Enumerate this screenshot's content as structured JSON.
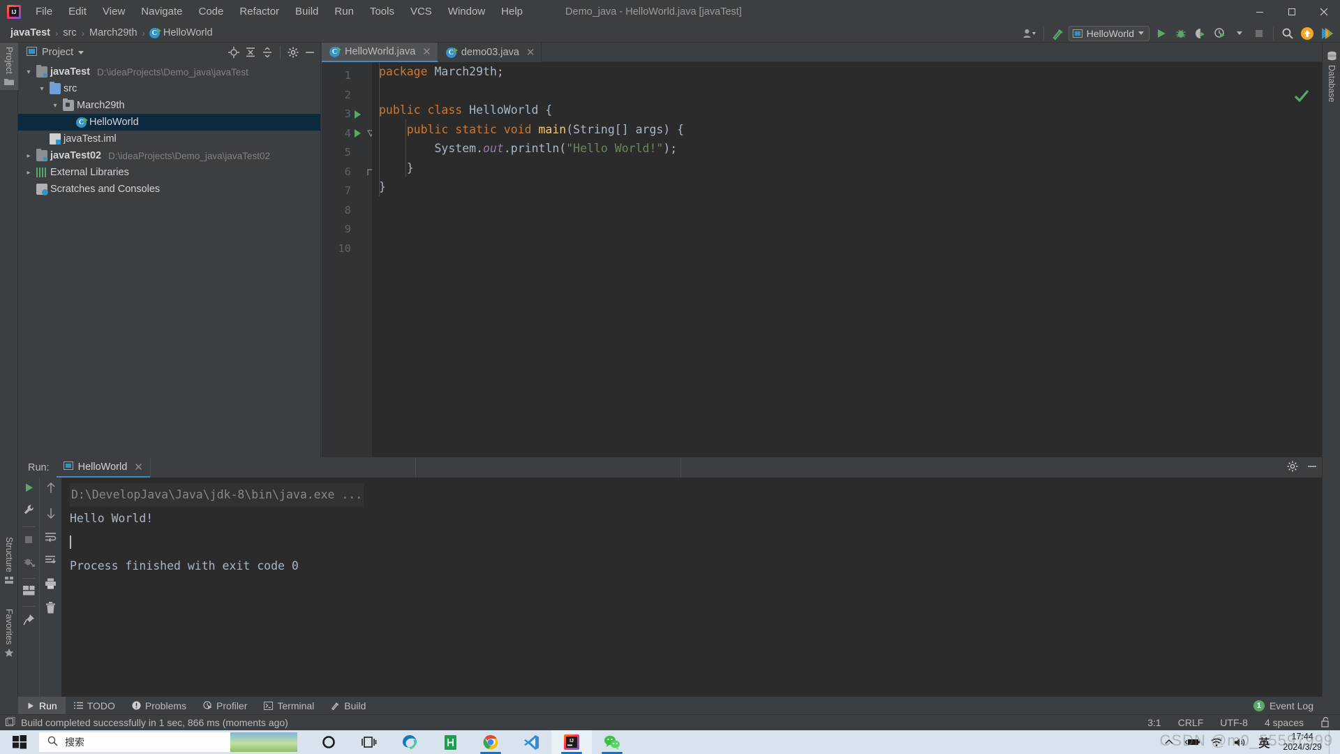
{
  "window": {
    "title": "Demo_java - HelloWorld.java [javaTest]",
    "app_icon": "intellij-idea-logo",
    "controls": {
      "minimize": "—",
      "maximize": "▢",
      "close": "✕"
    }
  },
  "menubar": {
    "items": [
      "File",
      "Edit",
      "View",
      "Navigate",
      "Code",
      "Refactor",
      "Build",
      "Run",
      "Tools",
      "VCS",
      "Window",
      "Help"
    ]
  },
  "navbar": {
    "breadcrumbs": [
      "javaTest",
      "src",
      "March29th",
      "HelloWorld"
    ],
    "separator": "›",
    "run_config": "HelloWorld",
    "actions": [
      "user-avatar-icon",
      "hammer-build-icon",
      "run-icon",
      "debug-icon",
      "coverage-icon",
      "profile-icon",
      "stop-icon",
      "search-everywhere-icon",
      "update-icon",
      "plugin-icon"
    ]
  },
  "left_strip": {
    "tabs": [
      {
        "label": "Project",
        "icon": "project-folder-icon",
        "active": true
      },
      {
        "label": "Structure",
        "icon": "structure-icon",
        "active": false
      },
      {
        "label": "Favorites",
        "icon": "star-icon",
        "active": false
      }
    ]
  },
  "right_strip": {
    "tabs": [
      {
        "label": "Database",
        "icon": "database-icon"
      }
    ]
  },
  "project_panel": {
    "title": "Project",
    "title_icon": "project-icon",
    "actions": [
      "locate-icon",
      "expand-all-icon",
      "collapse-all-icon",
      "settings-gear-icon",
      "hide-icon"
    ],
    "tree": [
      {
        "depth": 0,
        "arrow": "⌄",
        "icon": "module-icon",
        "label": "javaTest",
        "bold": true,
        "path": "D:\\ideaProjects\\Demo_java\\javaTest",
        "selected": false
      },
      {
        "depth": 1,
        "arrow": "⌄",
        "icon": "folder-icon",
        "label": "src",
        "bold": false,
        "path": "",
        "selected": false
      },
      {
        "depth": 2,
        "arrow": "⌄",
        "icon": "package-icon",
        "label": "March29th",
        "bold": false,
        "path": "",
        "selected": false
      },
      {
        "depth": 3,
        "arrow": "",
        "icon": "java-class-icon",
        "label": "HelloWorld",
        "bold": false,
        "path": "",
        "selected": true
      },
      {
        "depth": 1,
        "arrow": "",
        "icon": "iml-file-icon",
        "label": "javaTest.iml",
        "bold": false,
        "path": "",
        "selected": false
      },
      {
        "depth": 0,
        "arrow": "›",
        "icon": "module-icon",
        "label": "javaTest02",
        "bold": true,
        "path": "D:\\ideaProjects\\Demo_java\\javaTest02",
        "selected": false
      },
      {
        "depth": 0,
        "arrow": "›",
        "icon": "external-libraries-icon",
        "label": "External Libraries",
        "bold": false,
        "path": "",
        "selected": false
      },
      {
        "depth": 0,
        "arrow": "",
        "icon": "scratches-icon",
        "label": "Scratches and Consoles",
        "bold": false,
        "path": "",
        "selected": false
      }
    ]
  },
  "editor": {
    "tabs": [
      {
        "label": "HelloWorld.java",
        "icon": "java-class-icon",
        "active": true,
        "close": "✕"
      },
      {
        "label": "demo03.java",
        "icon": "java-class-icon",
        "active": false,
        "close": "✕"
      }
    ],
    "line_numbers": [
      "1",
      "2",
      "3",
      "4",
      "5",
      "6",
      "7",
      "8",
      "9",
      "10"
    ],
    "run_markers": [
      3,
      4
    ],
    "fold_markers": [
      4,
      6
    ],
    "inspection_status": "ok-checkmark",
    "lines": [
      [
        {
          "t": "package ",
          "c": "kw"
        },
        {
          "t": "March29th;",
          "c": "plain"
        }
      ],
      [],
      [
        {
          "t": "public class ",
          "c": "kw"
        },
        {
          "t": "HelloWorld {",
          "c": "plain"
        }
      ],
      [
        {
          "t": "    public static void ",
          "c": "kw"
        },
        {
          "t": "main",
          "c": "meth"
        },
        {
          "t": "(String[] args) {",
          "c": "plain"
        }
      ],
      [
        {
          "t": "        System.",
          "c": "plain"
        },
        {
          "t": "out",
          "c": "fld"
        },
        {
          "t": ".println(",
          "c": "plain"
        },
        {
          "t": "\"Hello World!\"",
          "c": "str"
        },
        {
          "t": ");",
          "c": "plain"
        }
      ],
      [
        {
          "t": "    }",
          "c": "plain"
        }
      ],
      [
        {
          "t": "}",
          "c": "plain"
        }
      ],
      [],
      [],
      []
    ]
  },
  "run_panel": {
    "label": "Run:",
    "tab": "HelloWorld",
    "tab_icon": "run-config-icon",
    "tab_close": "✕",
    "header_actions": [
      "settings-gear-icon",
      "hide-icon"
    ],
    "left_tools": [
      "rerun-icon",
      "wrench-settings-icon",
      "stop-icon",
      "debug-attach-icon",
      "layout-icon",
      "pin-icon"
    ],
    "right_tools": [
      "up-arrow-icon",
      "down-arrow-icon",
      "soft-wrap-icon",
      "scroll-to-end-icon",
      "print-icon",
      "trash-icon"
    ],
    "output": [
      {
        "text": "D:\\DevelopJava\\Java\\jdk-8\\bin\\java.exe ...",
        "style": "cmd"
      },
      {
        "text": "Hello World!",
        "style": "normal"
      },
      {
        "text": "",
        "style": "caret"
      },
      {
        "text": "Process finished with exit code 0",
        "style": "normal"
      }
    ]
  },
  "bottom_tabs": {
    "items": [
      {
        "label": "Run",
        "icon": "run-icon",
        "active": true
      },
      {
        "label": "TODO",
        "icon": "todo-list-icon",
        "active": false
      },
      {
        "label": "Problems",
        "icon": "problems-icon",
        "active": false
      },
      {
        "label": "Profiler",
        "icon": "profiler-icon",
        "active": false
      },
      {
        "label": "Terminal",
        "icon": "terminal-icon",
        "active": false
      },
      {
        "label": "Build",
        "icon": "hammer-build-icon",
        "active": false
      }
    ],
    "event_log": {
      "label": "Event Log",
      "count": "1"
    }
  },
  "statusbar": {
    "message": "Build completed successfully in 1 sec, 866 ms (moments ago)",
    "message_icon": "build-status-icon",
    "caret_position": "3:1",
    "line_separator": "CRLF",
    "encoding": "UTF-8",
    "indent": "4 spaces",
    "lock_icon": "unlocked-icon"
  },
  "taskbar": {
    "start_icon": "windows-logo-icon",
    "search_placeholder": "搜索",
    "search_icon": "search-icon",
    "pinned": [
      {
        "name": "cortana-icon"
      },
      {
        "name": "task-view-icon"
      },
      {
        "name": "microsoft-edge-icon"
      },
      {
        "name": "huawei-app-icon"
      },
      {
        "name": "google-chrome-icon"
      },
      {
        "name": "vscode-icon"
      },
      {
        "name": "intellij-idea-icon"
      },
      {
        "name": "wechat-icon"
      }
    ],
    "tray": [
      "show-hidden-icons-chevron",
      "battery-icon",
      "wifi-icon",
      "volume-icon"
    ],
    "ime": "英",
    "time": "17:44",
    "date": "2024/3/29"
  },
  "watermark": "CSDN @m0_55597999",
  "colors": {
    "chrome": "#3c3f41",
    "editor_bg": "#2b2b2b",
    "gutter_bg": "#313335",
    "selection": "#0d293e",
    "accent_blue": "#4a88c7",
    "green": "#59a869",
    "keyword_orange": "#cc7832",
    "string_green": "#6a8759",
    "method_yellow": "#ffc66d",
    "field_purple": "#9876aa",
    "text": "#a9b7c6"
  }
}
